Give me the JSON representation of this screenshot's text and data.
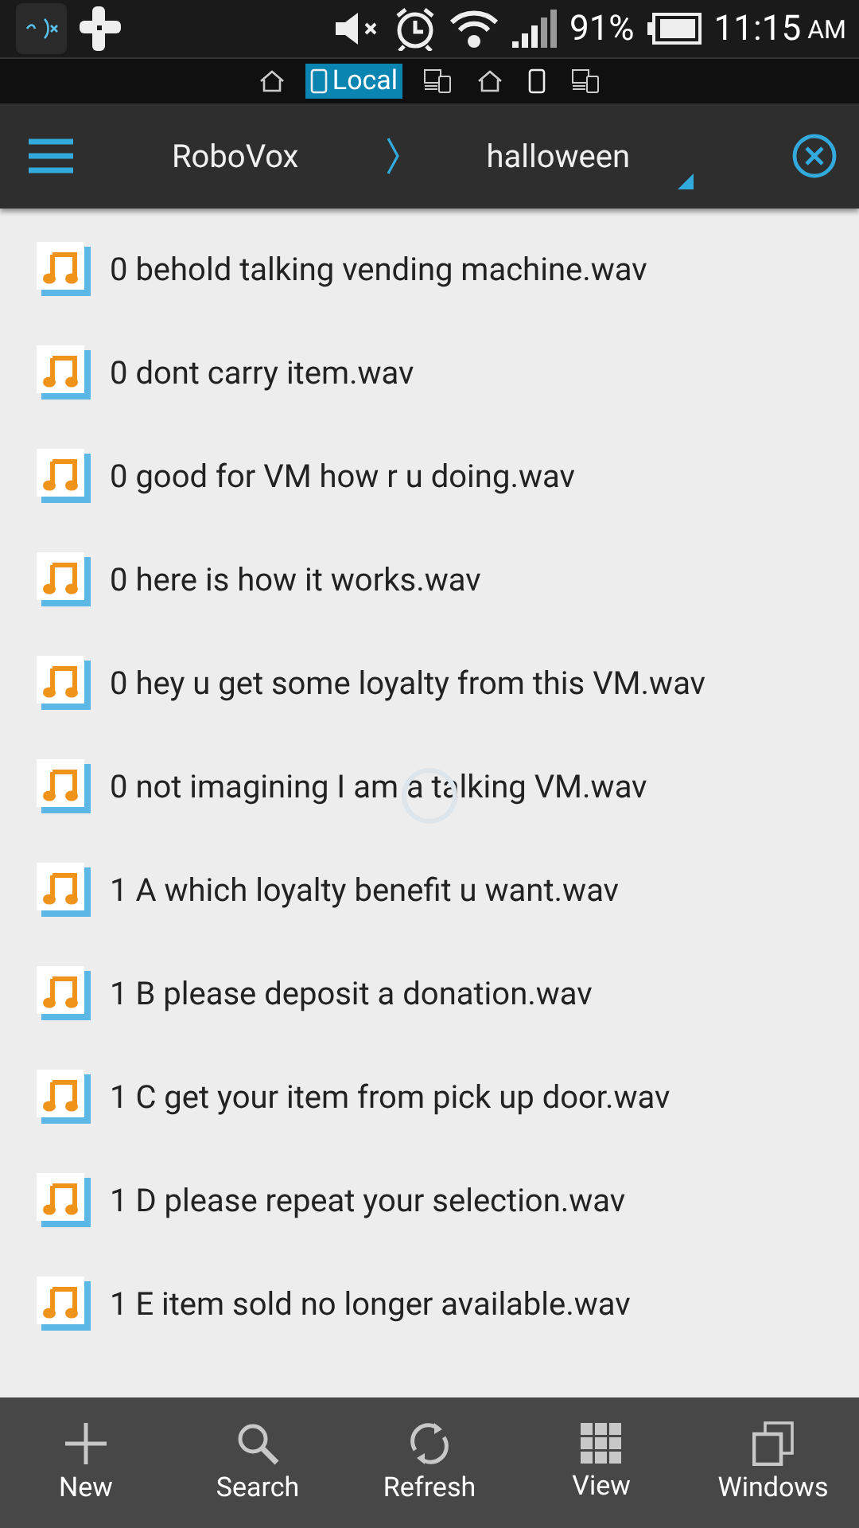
{
  "status_bar": {
    "battery": "91%",
    "time": "11:15",
    "ampm": "AM"
  },
  "locations": [
    {
      "kind": "home",
      "selected": false
    },
    {
      "kind": "phone",
      "label": "Local",
      "selected": true
    },
    {
      "kind": "network",
      "selected": false
    },
    {
      "kind": "home",
      "selected": false
    },
    {
      "kind": "phone",
      "selected": false
    },
    {
      "kind": "network",
      "selected": false
    }
  ],
  "breadcrumb": [
    "RoboVox",
    "halloween"
  ],
  "files": [
    {
      "name": "0 behold talking vending machine.wav"
    },
    {
      "name": "0 dont carry item.wav"
    },
    {
      "name": "0 good for VM how r u doing.wav"
    },
    {
      "name": "0 here is how it works.wav"
    },
    {
      "name": "0 hey u get some loyalty from this VM.wav"
    },
    {
      "name": "0 not imagining I am a talking VM.wav"
    },
    {
      "name": "1 A which loyalty benefit u want.wav"
    },
    {
      "name": "1 B please deposit a donation.wav"
    },
    {
      "name": "1 C get your item from pick up door.wav"
    },
    {
      "name": "1 D please repeat your selection.wav"
    },
    {
      "name": "1 E item sold no longer available.wav"
    }
  ],
  "toolbar": [
    {
      "kind": "new",
      "label": "New"
    },
    {
      "kind": "search",
      "label": "Search"
    },
    {
      "kind": "refresh",
      "label": "Refresh"
    },
    {
      "kind": "view",
      "label": "View"
    },
    {
      "kind": "windows",
      "label": "Windows"
    }
  ]
}
